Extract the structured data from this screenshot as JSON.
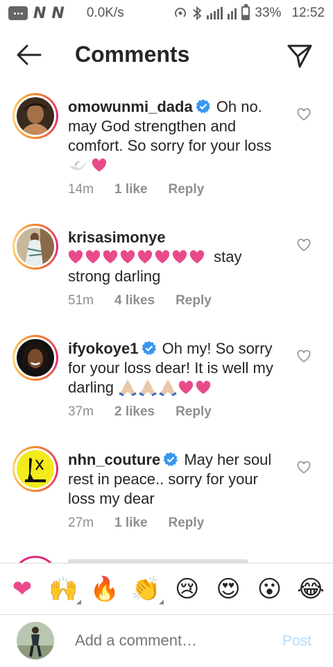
{
  "status_bar": {
    "network_letters": [
      "N",
      "N"
    ],
    "speed": "0.0K/s",
    "battery": "33%",
    "time": "12:52"
  },
  "header": {
    "title": "Comments",
    "back_icon": "arrow-left-icon",
    "send_icon": "direct-send-icon"
  },
  "comments": [
    {
      "username": "omowunmi_dada",
      "verified": true,
      "text": "Oh no. may God strengthen and comfort. So sorry for your loss",
      "time": "14m",
      "likes": "1 like",
      "reply": "Reply"
    },
    {
      "username": "krisasimonye",
      "verified": false,
      "text": "stay strong darling",
      "time": "51m",
      "likes": "4 likes",
      "reply": "Reply"
    },
    {
      "username": "ifyokoye1",
      "verified": true,
      "text_a": "Oh my! So sorry for your loss dear! It is well my darling",
      "time": "37m",
      "likes": "2 likes",
      "reply": "Reply"
    },
    {
      "username": "nhn_couture",
      "verified": true,
      "text": "May her soul rest in peace.. sorry for your loss my dear",
      "time": "27m",
      "likes": "1 like",
      "reply": "Reply"
    }
  ],
  "emoji_bar": [
    "❤",
    "🙌",
    "🔥",
    "👏",
    "😢",
    "😍",
    "😮",
    "😂"
  ],
  "composer": {
    "placeholder": "Add a comment…",
    "post_label": "Post"
  },
  "colors": {
    "heart_pink": "#e84a8a",
    "verified_blue": "#3897f0",
    "meta_gray": "#8e8e8e",
    "post_disabled": "#b3dbff"
  }
}
